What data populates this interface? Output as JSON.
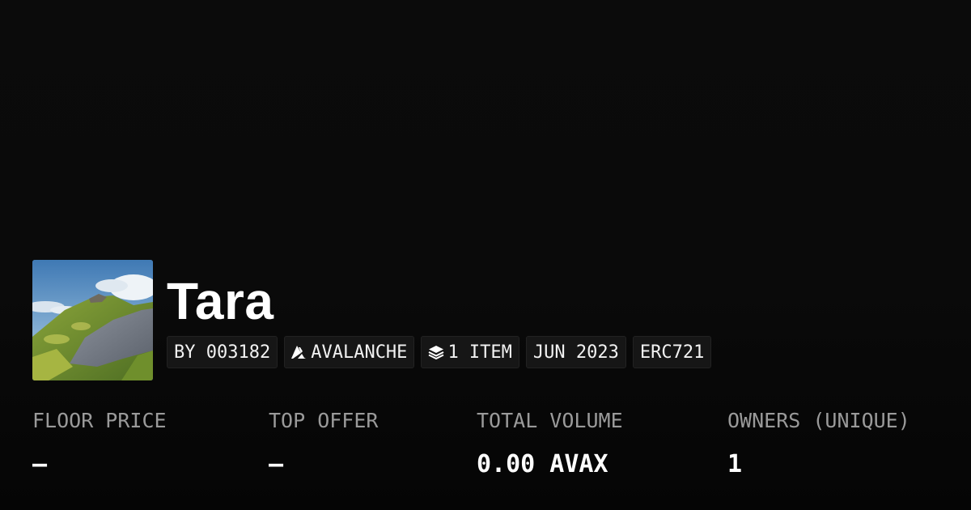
{
  "collection": {
    "name": "Tara",
    "image_alt": "mountain-landscape-thumbnail"
  },
  "tags": {
    "creator": "BY 003182",
    "chain": "AVALANCHE",
    "chain_icon": "avalanche-logo-icon",
    "items": "1 ITEM",
    "items_icon": "layers-icon",
    "date": "JUN 2023",
    "standard": "ERC721"
  },
  "stats": {
    "floor_price": {
      "label": "FLOOR PRICE",
      "value": "–"
    },
    "top_offer": {
      "label": "TOP OFFER",
      "value": "–"
    },
    "total_volume": {
      "label": "TOTAL VOLUME",
      "value": "0.00 AVAX"
    },
    "owners": {
      "label": "OWNERS (UNIQUE)",
      "value": "1"
    }
  },
  "colors": {
    "background": "#0a0a0a",
    "tag_background": "#161616",
    "label": "#9a9a9a",
    "value": "#ffffff"
  }
}
